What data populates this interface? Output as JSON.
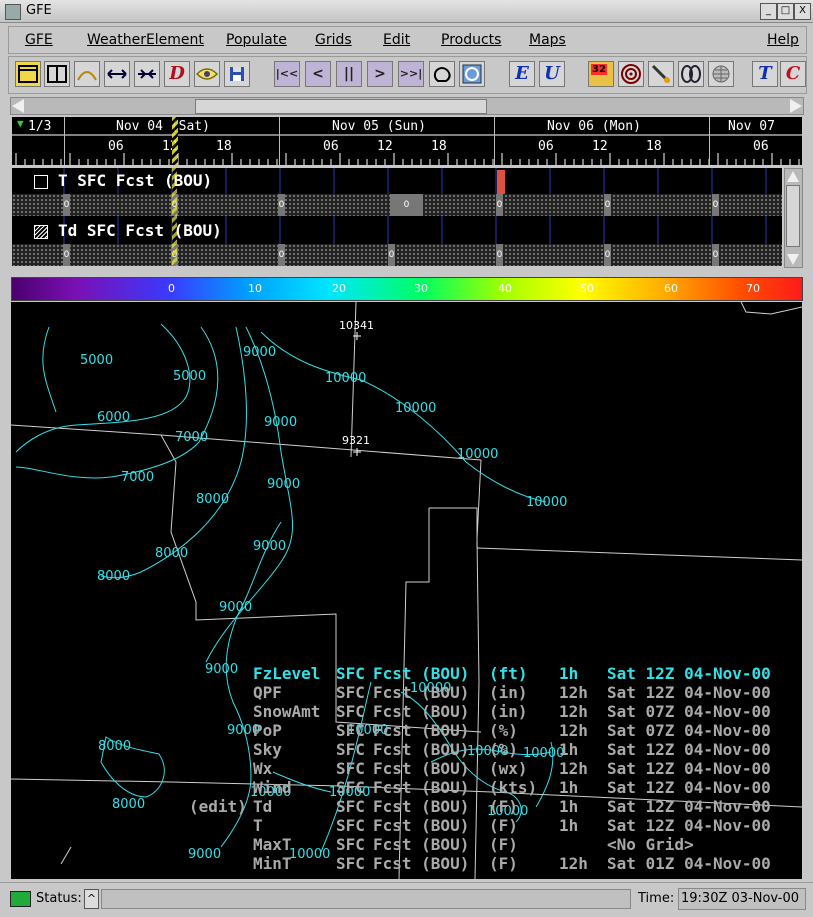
{
  "window": {
    "title": "GFE",
    "controls": [
      "_",
      "□",
      "X"
    ]
  },
  "menu": [
    "GFE",
    "WeatherElement",
    "Populate",
    "Grids",
    "Edit",
    "Products",
    "Maps",
    "Help"
  ],
  "toolbar": {
    "letters": {
      "d": "D",
      "e": "E",
      "u": "U",
      "t": "T",
      "c": "C"
    },
    "playback": [
      "|<<",
      "<",
      "||",
      ">",
      ">>|"
    ],
    "badge": "32"
  },
  "timescale": {
    "counter": "1/3",
    "days": [
      "Nov 04 (Sat)",
      "Nov 05 (Sun)",
      "Nov 06 (Mon)",
      "Nov 07"
    ],
    "hours": [
      "06",
      "12",
      "18",
      "06",
      "12",
      "18",
      "06",
      "12",
      "18",
      "06"
    ]
  },
  "grids": [
    {
      "name": "T SFC  Fcst (BOU)",
      "box_value": "0"
    },
    {
      "name": "Td SFC  Fcst (BOU)",
      "box_value": "0"
    }
  ],
  "colorbar": {
    "labels": [
      "0",
      "10",
      "20",
      "30",
      "40",
      "50",
      "60",
      "70"
    ]
  },
  "map": {
    "points": [
      "10341",
      "9321"
    ],
    "contour_labels": [
      "5000",
      "5000",
      "9000",
      "10000",
      "6000",
      "9000",
      "10000",
      "7000",
      "10000",
      "7000",
      "9000",
      "10000",
      "8000",
      "9000",
      "8000",
      "8000",
      "9000",
      "9000",
      "8000",
      "8000",
      "9000",
      "10000",
      "10000",
      "10000",
      "10000",
      "10000",
      "10000",
      "10000",
      "9000",
      "10000"
    ]
  },
  "legend": [
    {
      "edit": "",
      "name": "FzLevel",
      "level": "SFC",
      "model": "Fcst (BOU)",
      "units": "(ft)",
      "dur": "1h",
      "time": "Sat 12Z 04-Nov-00",
      "active": true
    },
    {
      "edit": "",
      "name": "QPF",
      "level": "SFC",
      "model": "Fcst (BOU)",
      "units": "(in)",
      "dur": "12h",
      "time": "Sat 12Z 04-Nov-00",
      "active": false
    },
    {
      "edit": "",
      "name": "SnowAmt",
      "level": "SFC",
      "model": "Fcst (BOU)",
      "units": "(in)",
      "dur": "12h",
      "time": "Sat 07Z 04-Nov-00",
      "active": false
    },
    {
      "edit": "",
      "name": "PoP",
      "level": "SFC",
      "model": "Fcst (BOU)",
      "units": "(%)",
      "dur": "12h",
      "time": "Sat 07Z 04-Nov-00",
      "active": false
    },
    {
      "edit": "",
      "name": "Sky",
      "level": "SFC",
      "model": "Fcst (BOU)",
      "units": "(%)",
      "dur": "1h",
      "time": "Sat 12Z 04-Nov-00",
      "active": false
    },
    {
      "edit": "",
      "name": "Wx",
      "level": "SFC",
      "model": "Fcst (BOU)",
      "units": "(wx)",
      "dur": "12h",
      "time": "Sat 12Z 04-Nov-00",
      "active": false
    },
    {
      "edit": "",
      "name": "Wind",
      "level": "SFC",
      "model": "Fcst (BOU)",
      "units": "(kts)",
      "dur": "1h",
      "time": "Sat 12Z 04-Nov-00",
      "active": false
    },
    {
      "edit": "(edit)",
      "name": "Td",
      "level": "SFC",
      "model": "Fcst (BOU)",
      "units": "(F)",
      "dur": "1h",
      "time": "Sat 12Z 04-Nov-00",
      "active": false
    },
    {
      "edit": "",
      "name": "T",
      "level": "SFC",
      "model": "Fcst (BOU)",
      "units": "(F)",
      "dur": "1h",
      "time": "Sat 12Z 04-Nov-00",
      "active": false
    },
    {
      "edit": "",
      "name": "MaxT",
      "level": "SFC",
      "model": "Fcst (BOU)",
      "units": "(F)",
      "dur": "",
      "time": "<No Grid>",
      "active": false
    },
    {
      "edit": "",
      "name": "MinT",
      "level": "SFC",
      "model": "Fcst (BOU)",
      "units": "(F)",
      "dur": "12h",
      "time": "Sat 01Z 04-Nov-00",
      "active": false
    }
  ],
  "colors": {
    "active": "#33e0e8",
    "inactive": "#a9a9a9",
    "contour": "#33e0e8"
  },
  "status": {
    "label": "Status:",
    "message": "",
    "time_label": "Time:",
    "time_value": "19:30Z 03-Nov-00"
  }
}
